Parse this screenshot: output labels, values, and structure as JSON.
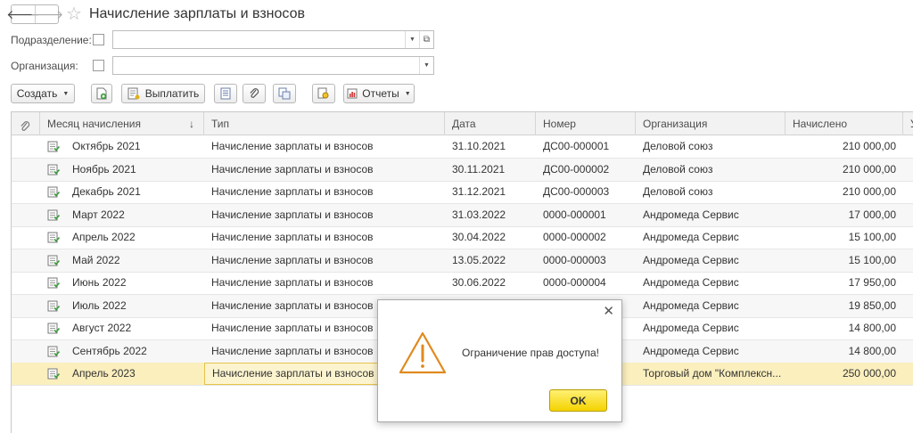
{
  "header": {
    "title": "Начисление зарплаты и взносов"
  },
  "filters": {
    "division_label": "Подразделение:",
    "organization_label": "Организация:"
  },
  "toolbar": {
    "create_label": "Создать",
    "pay_label": "Выплатить",
    "reports_label": "Отчеты"
  },
  "table": {
    "columns": [
      "Месяц начисления",
      "Тип",
      "Дата",
      "Номер",
      "Организация",
      "Начислено",
      "У"
    ],
    "sort_indicator": "↓",
    "rows": [
      {
        "month": "Октябрь 2021",
        "type": "Начисление зарплаты и взносов",
        "date": "31.10.2021",
        "number": "ДС00-000001",
        "org": "Деловой союз",
        "amount": "210 000,00"
      },
      {
        "month": "Ноябрь 2021",
        "type": "Начисление зарплаты и взносов",
        "date": "30.11.2021",
        "number": "ДС00-000002",
        "org": "Деловой союз",
        "amount": "210 000,00"
      },
      {
        "month": "Декабрь 2021",
        "type": "Начисление зарплаты и взносов",
        "date": "31.12.2021",
        "number": "ДС00-000003",
        "org": "Деловой союз",
        "amount": "210 000,00"
      },
      {
        "month": "Март 2022",
        "type": "Начисление зарплаты и взносов",
        "date": "31.03.2022",
        "number": "0000-000001",
        "org": "Андромеда Сервис",
        "amount": "17 000,00"
      },
      {
        "month": "Апрель 2022",
        "type": "Начисление зарплаты и взносов",
        "date": "30.04.2022",
        "number": "0000-000002",
        "org": "Андромеда Сервис",
        "amount": "15 100,00"
      },
      {
        "month": "Май 2022",
        "type": "Начисление зарплаты и взносов",
        "date": "13.05.2022",
        "number": "0000-000003",
        "org": "Андромеда Сервис",
        "amount": "15 100,00"
      },
      {
        "month": "Июнь 2022",
        "type": "Начисление зарплаты и взносов",
        "date": "30.06.2022",
        "number": "0000-000004",
        "org": "Андромеда Сервис",
        "amount": "17 950,00"
      },
      {
        "month": "Июль 2022",
        "type": "Начисление зарплаты и взносов",
        "date": "",
        "number": "",
        "org": "Андромеда Сервис",
        "amount": "19 850,00"
      },
      {
        "month": "Август 2022",
        "type": "Начисление зарплаты и взносов",
        "date": "",
        "number": "",
        "org": "Андромеда Сервис",
        "amount": "14 800,00"
      },
      {
        "month": "Сентябрь 2022",
        "type": "Начисление зарплаты и взносов",
        "date": "",
        "number": "",
        "org": "Андромеда Сервис",
        "amount": "14 800,00"
      },
      {
        "month": "Апрель 2023",
        "type": "Начисление зарплаты и взносов",
        "date": "",
        "number": "",
        "org": "Торговый дом \"Комплексн...",
        "amount": "250 000,00"
      }
    ],
    "selected_row": 10
  },
  "dialog": {
    "message": "Ограничение прав доступа!",
    "ok_label": "OK"
  },
  "colors": {
    "selected_row": "#fbefbe",
    "ok_button": "#f4d300",
    "warning_icon": "#e08a1e",
    "doc_icon_green": "#3a9a3a"
  }
}
